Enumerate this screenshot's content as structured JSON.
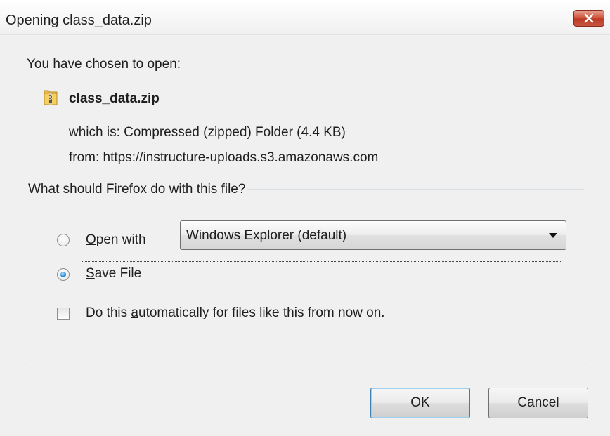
{
  "window": {
    "title": "Opening class_data.zip",
    "close_label": "×"
  },
  "intro": {
    "label": "You have chosen to open:"
  },
  "file": {
    "name": "class_data.zip",
    "icon": "zip-folder-icon",
    "which_is": "which is:  Compressed (zipped) Folder (4.4 KB)",
    "from": "from:  https://instructure-uploads.s3.amazonaws.com"
  },
  "action_group": {
    "legend": "What should Firefox do with this file?",
    "open_with": {
      "accel": "O",
      "rest": "pen with",
      "selected": false
    },
    "open_with_app": "Windows Explorer (default)",
    "save_file": {
      "accel": "S",
      "rest": "ave File",
      "selected": true
    },
    "auto": {
      "prefix": "Do this ",
      "accel": "a",
      "rest": "utomatically for files like this from now on.",
      "checked": false
    }
  },
  "buttons": {
    "ok": "OK",
    "cancel": "Cancel"
  },
  "colors": {
    "close_button": "#c8573f",
    "radio_selected": "#2a8bd6",
    "dialog_bg": "#f0f0f0"
  }
}
